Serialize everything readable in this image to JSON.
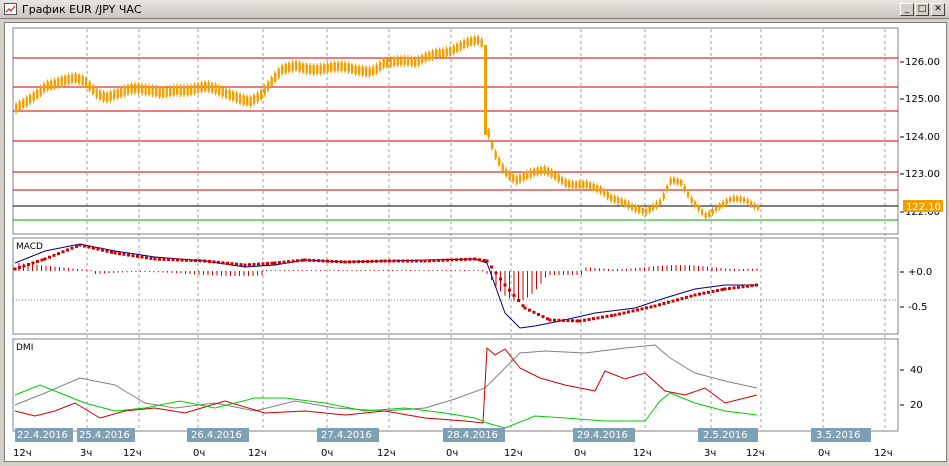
{
  "window": {
    "title": "График EUR /JPY ЧАС",
    "minimize_glyph": "_",
    "maximize_glyph": "□",
    "close_glyph": "✕"
  },
  "price_panel": {
    "y_ticks": [
      "126.00",
      "125.00",
      "124.00",
      "123.00",
      "122.00"
    ],
    "current_price_label": "122.10",
    "current_price_color": "#f0a000"
  },
  "macd_panel": {
    "label": "MACD",
    "y_ticks": [
      "+0.0",
      "-0.5"
    ]
  },
  "dmi_panel": {
    "label": "DMI",
    "y_ticks": [
      "40",
      "20"
    ]
  },
  "date_labels": [
    "22.4.2016",
    "25.4.2016",
    "26.4.2016",
    "27.4.2016",
    "28.4.2016",
    "29.4.2016",
    "2.5.2016",
    "3.5.2016"
  ],
  "hour_labels": [
    "12ч",
    "3ч",
    "12ч",
    "0ч",
    "12ч",
    "0ч",
    "12ч",
    "0ч",
    "12ч",
    "0ч",
    "12ч",
    "3ч",
    "12ч",
    "0ч",
    "12ч"
  ],
  "colors": {
    "candle": "#f0a000",
    "grid_red": "#cc0000",
    "macd_line": "#000080",
    "macd_signal": "#cc0000",
    "dmi_adx": "#808080",
    "dmi_plus": "#cc0000",
    "dmi_minus": "#00cc00",
    "date_tag_bg": "#7f9fb5"
  }
}
